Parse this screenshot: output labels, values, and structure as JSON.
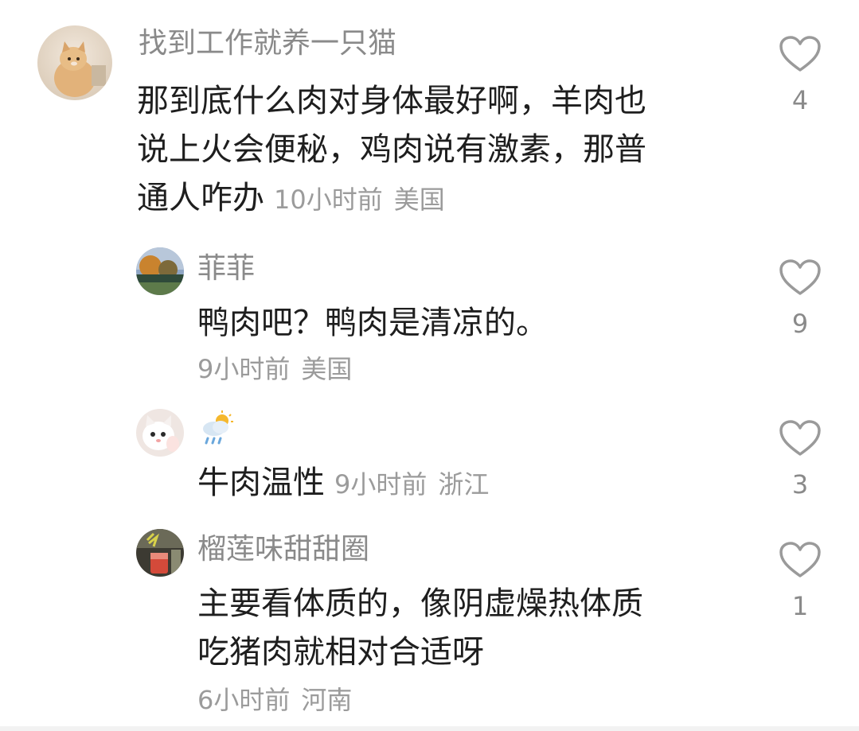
{
  "comments": [
    {
      "username": "找到工作就养一只猫",
      "lines": [
        "那到底什么肉对身体最好啊，羊肉也",
        "说上火会便秘，鸡肉说有激素，那普",
        "通人咋办"
      ],
      "time": "10小时前",
      "location": "美国",
      "likes": "4",
      "avatar_icon": "cat-photo-avatar"
    },
    {
      "username": "菲菲",
      "lines": [
        "鸭肉吧？鸭肉是清凉的。"
      ],
      "time": "9小时前",
      "location": "美国",
      "likes": "9",
      "avatar_icon": "landscape-photo-avatar"
    },
    {
      "username_icon": "rain-cloud-sun-icon",
      "lines": [
        "牛肉温性"
      ],
      "time": "9小时前",
      "location": "浙江",
      "likes": "3",
      "avatar_icon": "white-cat-avatar"
    },
    {
      "username": "榴莲味甜甜圈",
      "lines": [
        "主要看体质的，像阴虚燥热体质",
        "吃猪肉就相对合适呀"
      ],
      "time": "6小时前",
      "location": "河南",
      "likes": "1",
      "avatar_icon": "drink-photo-avatar"
    }
  ],
  "like_icon": "heart-outline-icon"
}
